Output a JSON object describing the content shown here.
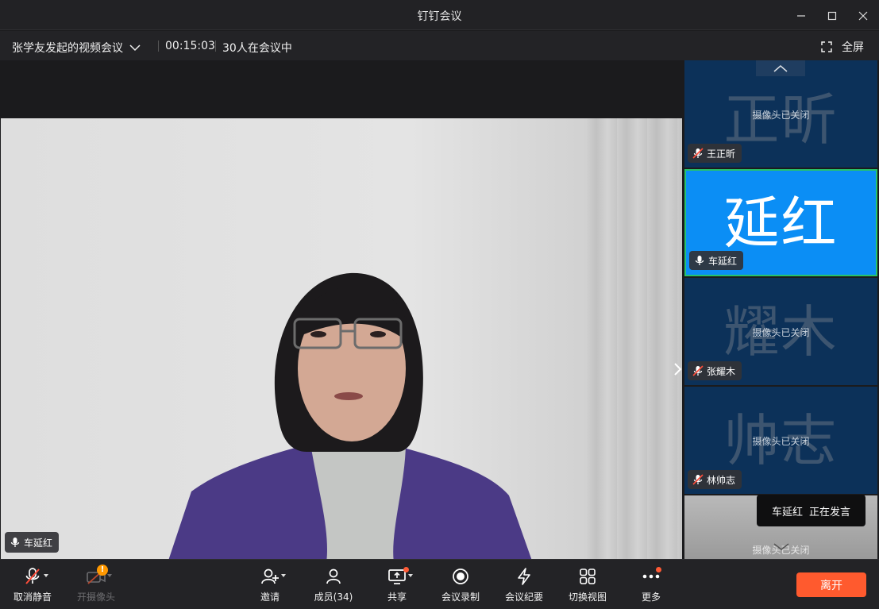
{
  "window": {
    "title": "钉钉会议"
  },
  "meeting": {
    "title": "张学友发起的视频会议",
    "timer": "00:15:03",
    "participants_in_meeting": "30人在会议中",
    "fullscreen_label": "全屏"
  },
  "main_video": {
    "speaker_name": "车延红"
  },
  "gallery": {
    "tiles": [
      {
        "big_text": "正昕",
        "camera_status": "摄像头已关闭",
        "name": "王正昕",
        "muted": true
      },
      {
        "big_text": "延红",
        "camera_status": "",
        "name": "车延红",
        "muted": false,
        "active": true
      },
      {
        "big_text": "耀木",
        "camera_status": "摄像头已关闭",
        "name": "张耀木",
        "muted": true
      },
      {
        "big_text": "帅志",
        "camera_status": "摄像头已关闭",
        "name": "林帅志",
        "muted": true
      },
      {
        "big_text": "",
        "camera_status": "摄像头已关闭",
        "name": "",
        "muted": false
      }
    ]
  },
  "speaking_toast": {
    "name": "车延红",
    "status": "正在发言"
  },
  "toolbar": {
    "unmute": "取消静音",
    "camera": "开摄像头",
    "invite": "邀请",
    "members": "成员(34)",
    "share": "共享",
    "record": "会议录制",
    "minutes": "会议纪要",
    "switch_view": "切换视图",
    "more": "更多",
    "leave": "离开"
  },
  "colors": {
    "accent_active": "#0b8ef5",
    "tile_bg": "#0c3159",
    "leave_button": "#ff5a2e",
    "speaking_border": "#27c26b",
    "notification_dot": "#ff5a35"
  }
}
